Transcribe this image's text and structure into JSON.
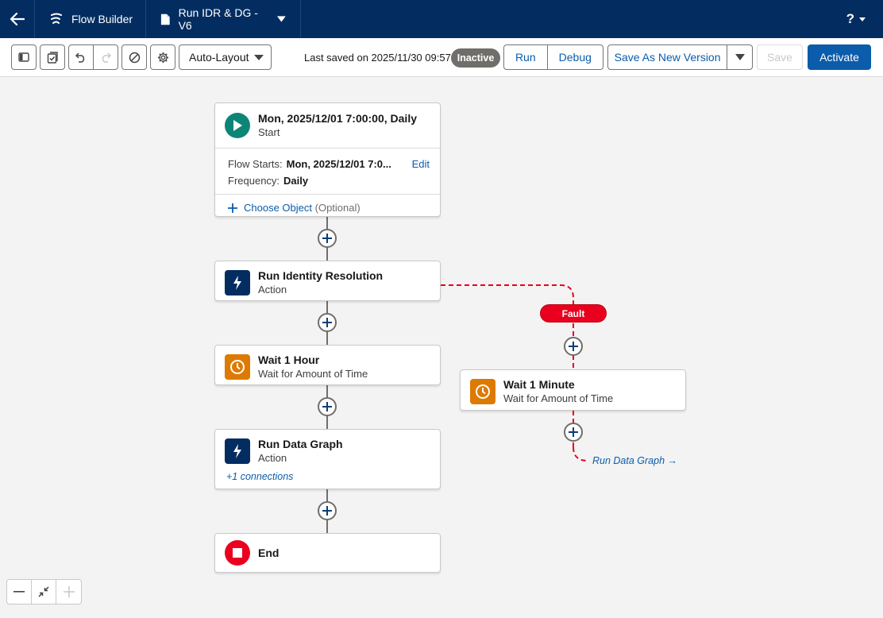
{
  "header": {
    "app_name": "Flow Builder",
    "flow_name": "Run IDR & DG - V6",
    "help": "?"
  },
  "toolbar": {
    "layout_select": "Auto-Layout",
    "last_saved": "Last saved on 2025/11/30 09:57",
    "status_badge": "Inactive",
    "run": "Run",
    "debug": "Debug",
    "save_as_new_version": "Save As New Version",
    "save": "Save",
    "activate": "Activate"
  },
  "colors": {
    "header_bg": "#032d60",
    "brand_blue": "#0b5cab",
    "start_green": "#0c8577",
    "action_navy": "#032d60",
    "wait_orange": "#dd7a01",
    "end_red": "#ea001e",
    "fault_red": "#ea001e"
  },
  "start": {
    "title": "Mon, 2025/12/01 7:00:00, Daily",
    "subtitle": "Start",
    "flow_starts_label": "Flow Starts:",
    "flow_starts_value": "Mon, 2025/12/01 7:0...",
    "edit": "Edit",
    "frequency_label": "Frequency:",
    "frequency_value": "Daily",
    "choose_object": "Choose Object",
    "optional": "(Optional)"
  },
  "nodes": {
    "identity": {
      "title": "Run Identity Resolution",
      "subtitle": "Action",
      "icon": "lightning-icon"
    },
    "wait_hour": {
      "title": "Wait 1 Hour",
      "subtitle": "Wait for Amount of Time",
      "icon": "clock-icon"
    },
    "data_graph": {
      "title": "Run Data Graph",
      "subtitle": "Action",
      "connections": "+1 connections",
      "icon": "lightning-icon"
    },
    "end": {
      "title": "End",
      "icon": "stop-icon"
    },
    "wait_minute": {
      "title": "Wait 1 Minute",
      "subtitle": "Wait for Amount of Time",
      "icon": "clock-icon"
    }
  },
  "fault": {
    "label": "Fault",
    "goto": "Run Data Graph →"
  }
}
